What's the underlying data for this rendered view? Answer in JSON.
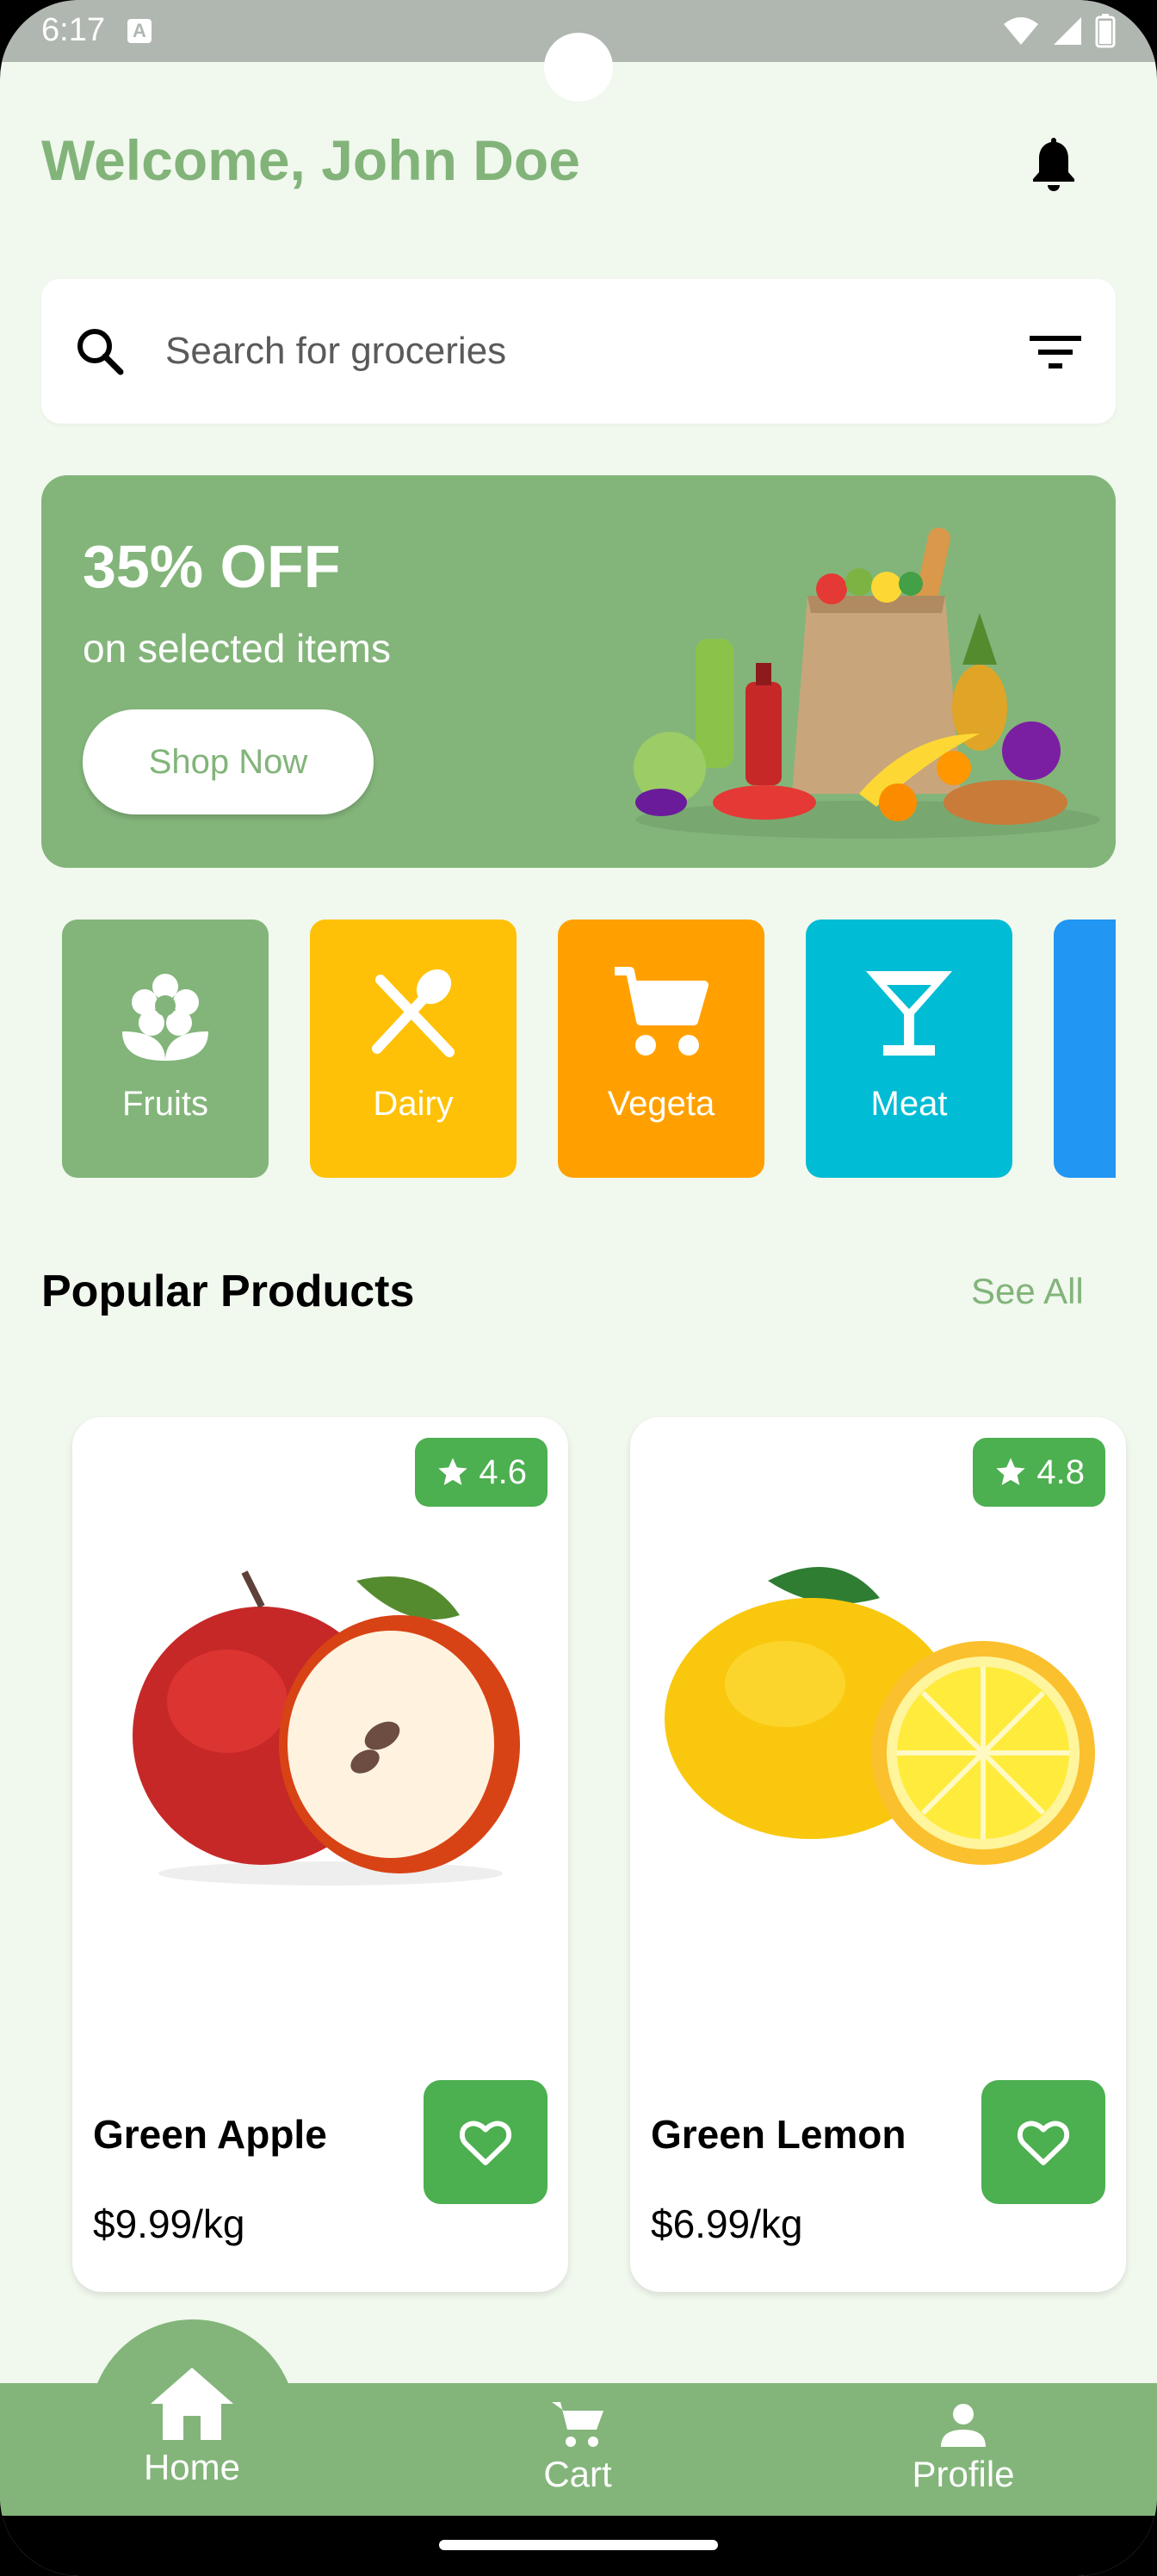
{
  "status_bar": {
    "time": "6:17",
    "a_glyph": "A"
  },
  "header": {
    "title": "Welcome, John Doe"
  },
  "search": {
    "placeholder": "Search for groceries"
  },
  "promo": {
    "title": "35% OFF",
    "subtitle": "on selected items",
    "button_label": "Shop Now"
  },
  "categories": [
    {
      "label": "Fruits",
      "icon": "flower-icon",
      "color": "#83B57A"
    },
    {
      "label": "Dairy",
      "icon": "utensils-icon",
      "color": "#FFC107"
    },
    {
      "label": "Vegeta",
      "icon": "cart-icon",
      "color": "#FFA000"
    },
    {
      "label": "Meat",
      "icon": "cocktail-icon",
      "color": "#00BCD4"
    },
    {
      "label": "",
      "icon": "partial-tile",
      "color": "#2196F3"
    }
  ],
  "popular": {
    "title": "Popular Products",
    "see_all": "See All"
  },
  "products": [
    {
      "name": "Green Apple",
      "price": "$9.99/kg",
      "rating": "4.6"
    },
    {
      "name": "Green Lemon",
      "price": "$6.99/kg",
      "rating": "4.8"
    }
  ],
  "nav": {
    "home": "Home",
    "cart": "Cart",
    "profile": "Profile"
  },
  "colors": {
    "accent": "#82B47A",
    "button_green": "#4CAF50",
    "background": "#F1F8EE"
  }
}
